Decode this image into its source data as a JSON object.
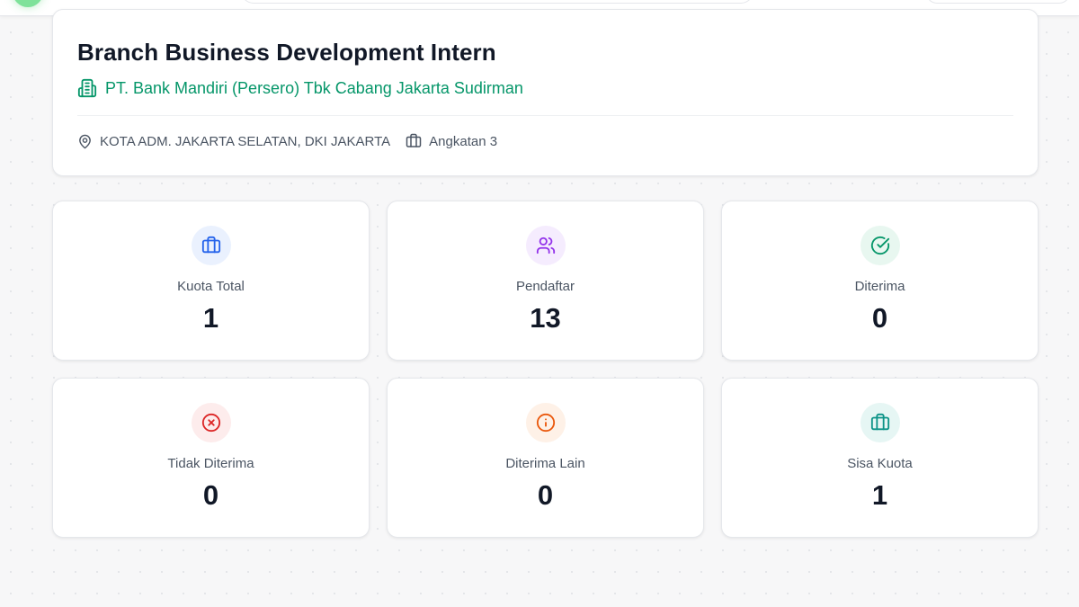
{
  "job": {
    "title": "Branch Business Development Intern",
    "company": "PT. Bank Mandiri (Persero) Tbk Cabang Jakarta Sudirman",
    "location": "KOTA ADM. JAKARTA SELATAN, DKI JAKARTA",
    "batch": "Angkatan 3"
  },
  "stats": [
    {
      "label": "Kuota Total",
      "value": "1",
      "icon": "briefcase-icon",
      "color": "#2563eb",
      "bg": "#eaf1fe"
    },
    {
      "label": "Pendaftar",
      "value": "13",
      "icon": "users-icon",
      "color": "#9333ea",
      "bg": "#f5ecfe"
    },
    {
      "label": "Diterima",
      "value": "0",
      "icon": "check-circle-icon",
      "color": "#059669",
      "bg": "#e8f7f0"
    },
    {
      "label": "Tidak Diterima",
      "value": "0",
      "icon": "x-circle-icon",
      "color": "#dc2626",
      "bg": "#fdecec"
    },
    {
      "label": "Diterima Lain",
      "value": "0",
      "icon": "info-circle-icon",
      "color": "#ea580c",
      "bg": "#fef1e7"
    },
    {
      "label": "Sisa Kuota",
      "value": "1",
      "icon": "briefcase-icon",
      "color": "#0d9488",
      "bg": "#e6f6f4"
    }
  ],
  "colors": {
    "accent": "#059669",
    "text": "#111827",
    "muted": "#4b5563"
  }
}
